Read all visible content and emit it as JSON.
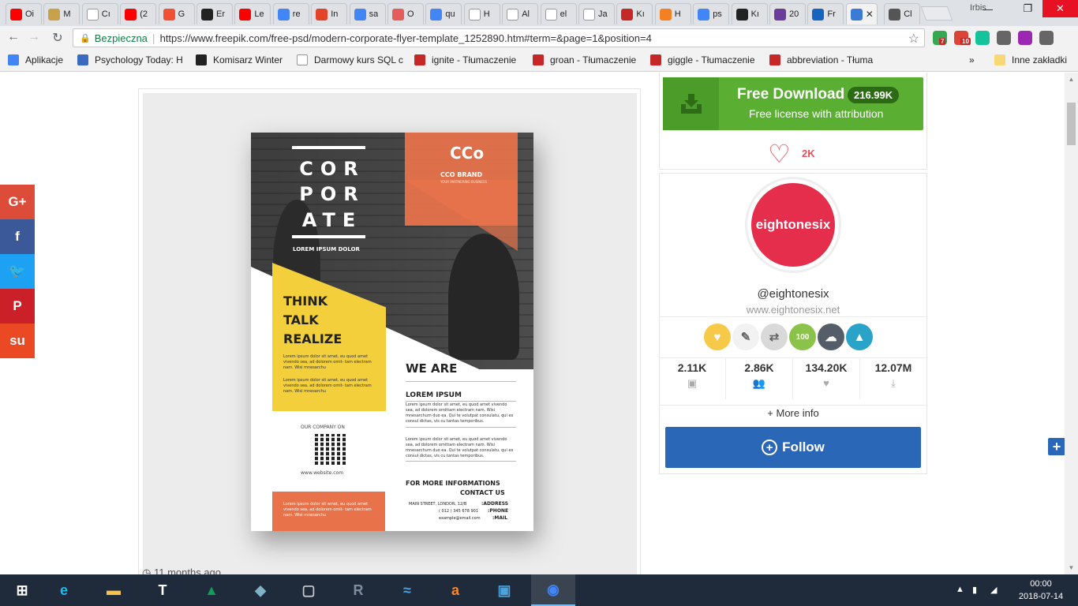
{
  "browser": {
    "tabs": [
      {
        "label": "Oi",
        "icon": "youtube-icon",
        "color": "#ff0000"
      },
      {
        "label": "M",
        "icon": "image-favicon-icon",
        "color": "#c8a24a"
      },
      {
        "label": "Cı",
        "icon": "page-icon",
        "color": "#ffffff"
      },
      {
        "label": "(2",
        "icon": "youtube-icon",
        "color": "#ff0000"
      },
      {
        "label": "G",
        "icon": "git-icon",
        "color": "#f05133"
      },
      {
        "label": "Er",
        "icon": "github-icon",
        "color": "#222222"
      },
      {
        "label": "Le",
        "icon": "youtube-icon",
        "color": "#ff0000"
      },
      {
        "label": "re",
        "icon": "google-icon",
        "color": "#4285f4"
      },
      {
        "label": "In",
        "icon": "gitlab-icon",
        "color": "#e24329"
      },
      {
        "label": "sa",
        "icon": "google-icon",
        "color": "#4285f4"
      },
      {
        "label": "O",
        "icon": "u-icon",
        "color": "#e35d5d"
      },
      {
        "label": "qu",
        "icon": "google-icon",
        "color": "#4285f4"
      },
      {
        "label": "H",
        "icon": "page-icon",
        "color": "#ffffff"
      },
      {
        "label": "Al",
        "icon": "page-icon",
        "color": "#ffffff"
      },
      {
        "label": "el",
        "icon": "page-icon",
        "color": "#ffffff"
      },
      {
        "label": "Ja",
        "icon": "wiki-icon",
        "color": "#ffffff"
      },
      {
        "label": "Kı",
        "icon": "record-icon",
        "color": "#c62828"
      },
      {
        "label": "H",
        "icon": "stackoverflow-icon",
        "color": "#f48024"
      },
      {
        "label": "ps",
        "icon": "google-icon",
        "color": "#4285f4"
      },
      {
        "label": "Kı",
        "icon": "cube-icon",
        "color": "#222222"
      },
      {
        "label": "20",
        "icon": "colorlib-icon",
        "color": "#6a3d9a"
      },
      {
        "label": "Fr",
        "icon": "code-icon",
        "color": "#1565c0"
      },
      {
        "label": "",
        "icon": "freepik-icon",
        "color": "#3a7bd5",
        "active": true
      },
      {
        "label": "Cl",
        "icon": "avatar-icon",
        "color": "#555555"
      }
    ],
    "user": "Irbis",
    "secure_label": "Bezpieczna",
    "url": "https://www.freepik.com/free-psd/modern-corporate-flyer-template_1252890.htm#term=&page=1&position=4",
    "extensions": [
      {
        "icon": "extension-green-icon",
        "badge": "7",
        "color": "#34a853"
      },
      {
        "icon": "extension-red-icon",
        "badge": "10",
        "color": "#db4437"
      },
      {
        "icon": "grammarly-icon",
        "badge": "",
        "color": "#15c39a"
      },
      {
        "icon": "eyedropper-icon",
        "badge": "",
        "color": "#666666"
      },
      {
        "icon": "colorwheel-icon",
        "badge": "",
        "color": "#9c27b0"
      },
      {
        "icon": "menu-icon",
        "badge": "",
        "color": "#666666"
      }
    ],
    "bookmarks": [
      {
        "label": "Aplikacje",
        "icon": "apps-icon",
        "color": "#4285f4"
      },
      {
        "label": "Psychology Today: H",
        "icon": "pt-icon",
        "color": "#3a6bc1"
      },
      {
        "label": "Komisarz Winter",
        "icon": "headphones-icon",
        "color": "#222222"
      },
      {
        "label": "Darmowy kurs SQL c",
        "icon": "page-icon",
        "color": "#ffffff"
      },
      {
        "label": "ignite - Tłumaczenie",
        "icon": "diki-icon",
        "color": "#c62828"
      },
      {
        "label": "groan - Tłumaczenie",
        "icon": "diki-icon",
        "color": "#c62828"
      },
      {
        "label": "giggle - Tłumaczenie",
        "icon": "diki-icon",
        "color": "#c62828"
      },
      {
        "label": "abbreviation - Tłuma",
        "icon": "diki-icon",
        "color": "#c62828"
      }
    ],
    "bookmarks_more": "»",
    "other_bookmarks": "Inne zakładki"
  },
  "share": [
    {
      "label": "G+",
      "icon": "google-plus-icon",
      "color": "#dd4b39"
    },
    {
      "label": "f",
      "icon": "facebook-icon",
      "color": "#3b5998"
    },
    {
      "label": "🐦",
      "icon": "twitter-icon",
      "color": "#1da1f2"
    },
    {
      "label": "P",
      "icon": "pinterest-icon",
      "color": "#cb2027"
    },
    {
      "label": "su",
      "icon": "stumbleupon-icon",
      "color": "#eb4924"
    }
  ],
  "flyer": {
    "title_lines": [
      "COR",
      "POR",
      "ATE"
    ],
    "subtitle": "LOREM IPSUM DOLOR",
    "brand_logo": "CCo",
    "brand_name": "CCO BRAND",
    "brand_tagline": "YOUR PARTNERING BUSINESS",
    "think": "THINK",
    "talk": "TALK",
    "realize": "REALIZE",
    "lorem_short_1": "Lorem ipsum dolor sit amet, eu quod amet vivendo sea, ad dolorem omit- tam electram nam. Wisi mnesarchu",
    "lorem_short_2": "Lorem ipsum dolor sit amet, eu quod amet vivendo sea, ad dolorem omit- tam electram nam. Wisi mnesarchu",
    "we_are": "WE ARE",
    "lorem_ipsum_heading": "LOREM IPSUM",
    "lorem_long_1": "Lorem ipsum dolor sit amet, eu quod amet vivendo sea, ad dolorem omittam electram nam. Wisi mnesarchum duo ea. Qui te volutpat consulatu, qui ex consul dictas, vis cu tantas temporibus.",
    "lorem_long_2": "Lorem ipsum dolor sit amet, eu quod amet vivendo sea, ad dolorem omittam electram nam. Wisi mnesarchum duo ea. Qui te volutpat consulatu, qui ex consul dictas, vis cu tantas temporibus.",
    "company_on": "OUR COMPANY ON",
    "website": "www.website.com",
    "more_info": "FOR MORE INFORMATIONS",
    "contact_us": "CONTACT US",
    "address_value": "MAIN STREET, LONDON, 12/B",
    "address_label": ":ADDRESS",
    "phone_value": "( 012 ) 345 678 901",
    "phone_label": ":PHONE",
    "mail_value": "example@email.com",
    "mail_label": ":MAIL",
    "footer_lorem": "Lorem ipsum dolor sit amet, eu quod amet vivendo sea, ad dolorem omit- tam electram nam. Wisi mnesarchu"
  },
  "time_ago": "11 months ago",
  "download": {
    "title": "Free Download",
    "count": "216.99K",
    "subtitle": "Free license with attribution",
    "likes": "2K"
  },
  "author": {
    "avatar_text": "eightonesix",
    "handle": "@eightonesix",
    "website": "www.eightonesix.net",
    "badges": [
      {
        "icon": "heart-medal-icon",
        "color": "#f7c948",
        "text": "♥"
      },
      {
        "icon": "pencil-icon",
        "color": "#f2f2f2",
        "text": "✎"
      },
      {
        "icon": "share-shield-icon",
        "color": "#d9d9d9",
        "text": "⇄"
      },
      {
        "icon": "comments-100-icon",
        "color": "#8bc34a",
        "text": "100"
      },
      {
        "icon": "storm-cloud-icon",
        "color": "#555e68",
        "text": "☁"
      },
      {
        "icon": "flame-globe-icon",
        "color": "#29a3c8",
        "text": "▲"
      }
    ],
    "stats": [
      {
        "value": "2.11K",
        "icon": "image-icon",
        "glyph": "▣"
      },
      {
        "value": "2.86K",
        "icon": "followers-icon",
        "glyph": "👥"
      },
      {
        "value": "134.20K",
        "icon": "heart-icon",
        "glyph": "♥"
      },
      {
        "value": "12.07M",
        "icon": "download-icon",
        "glyph": "⤓"
      }
    ],
    "more_info": "+ More info",
    "follow": "Follow"
  },
  "taskbar": {
    "apps": [
      {
        "icon": "windows-start-icon",
        "glyph": "⊞",
        "color": "#ffffff"
      },
      {
        "icon": "internet-explorer-icon",
        "glyph": "e",
        "color": "#1ebbee"
      },
      {
        "icon": "file-explorer-icon",
        "glyph": "▬",
        "color": "#f8c14a"
      },
      {
        "icon": "typora-icon",
        "glyph": "T",
        "color": "#ffffff"
      },
      {
        "icon": "google-drive-icon",
        "glyph": "▲",
        "color": "#0f9d58"
      },
      {
        "icon": "sublime-icon",
        "glyph": "◆",
        "color": "#7fb2c7"
      },
      {
        "icon": "virtual-machine-icon",
        "glyph": "▢",
        "color": "#cccccc"
      },
      {
        "icon": "r-studio-icon",
        "glyph": "R",
        "color": "#7f8da0"
      },
      {
        "icon": "wunderlist-icon",
        "glyph": "≈",
        "color": "#4aa3df"
      },
      {
        "icon": "avast-icon",
        "glyph": "a",
        "color": "#f7882f"
      },
      {
        "icon": "frame-app-icon",
        "glyph": "▣",
        "color": "#4aa3df"
      },
      {
        "icon": "chrome-icon",
        "glyph": "◉",
        "color": "#4285f4",
        "active": true
      }
    ],
    "time": "00:00",
    "date": "2018-07-14"
  }
}
